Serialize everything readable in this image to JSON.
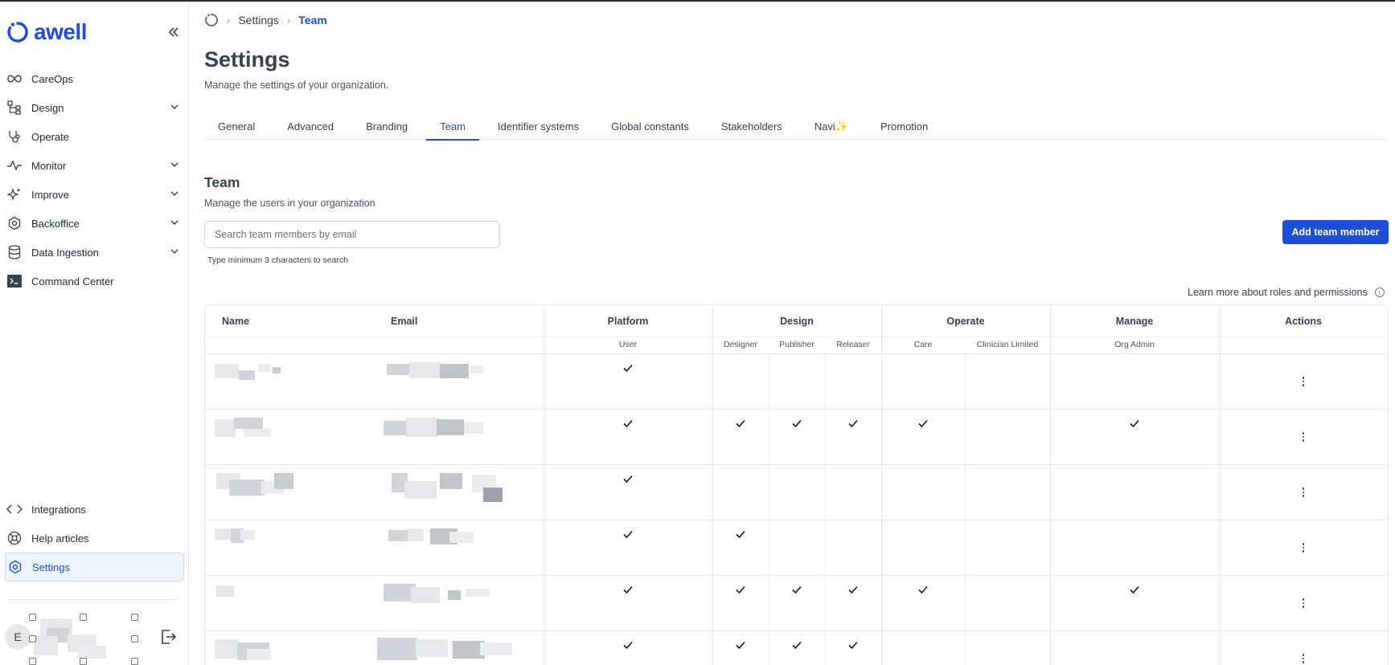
{
  "brand": {
    "name": "awell",
    "accent": "#1d4ed8"
  },
  "sidebar": {
    "items": [
      {
        "label": "CareOps",
        "icon": "infinity-icon",
        "chevron": false
      },
      {
        "label": "Design",
        "icon": "flow-tree-icon",
        "chevron": true
      },
      {
        "label": "Operate",
        "icon": "stethoscope-icon",
        "chevron": false
      },
      {
        "label": "Monitor",
        "icon": "pulse-icon",
        "chevron": true
      },
      {
        "label": "Improve",
        "icon": "sparkles-icon",
        "chevron": true
      },
      {
        "label": "Backoffice",
        "icon": "cog-icon",
        "chevron": true
      },
      {
        "label": "Data Ingestion",
        "icon": "database-icon",
        "chevron": true
      },
      {
        "label": "Command Center",
        "icon": "terminal-icon",
        "chevron": false
      }
    ],
    "bottom_items": [
      {
        "label": "Integrations",
        "icon": "code-icon"
      },
      {
        "label": "Help articles",
        "icon": "lifebuoy-icon"
      },
      {
        "label": "Settings",
        "icon": "settings-icon",
        "active": true
      }
    ],
    "user_initial": "E"
  },
  "breadcrumb": {
    "items": [
      "Settings",
      "Team"
    ]
  },
  "page": {
    "title": "Settings",
    "subtitle": "Manage the settings of your organization."
  },
  "tabs": [
    {
      "label": "General"
    },
    {
      "label": "Advanced"
    },
    {
      "label": "Branding"
    },
    {
      "label": "Team",
      "active": true
    },
    {
      "label": "Identifier systems"
    },
    {
      "label": "Global constants"
    },
    {
      "label": "Stakeholders"
    },
    {
      "label": "Navi✨"
    },
    {
      "label": "Promotion"
    }
  ],
  "team": {
    "title": "Team",
    "subtitle": "Manage the users in your organization",
    "search_placeholder": "Search team members by email",
    "search_hint": "Type minimum 3 characters to search",
    "add_button": "Add team member",
    "learn_more": "Learn more about roles and permissions"
  },
  "table": {
    "headers": {
      "name": "Name",
      "email": "Email",
      "platform": "Platform",
      "design": "Design",
      "operate": "Operate",
      "manage": "Manage",
      "actions": "Actions"
    },
    "subheaders": [
      "User",
      "Designer",
      "Publisher",
      "Releaser",
      "Care",
      "Clinician Limited",
      "Org Admin"
    ],
    "rows": [
      {
        "roles": [
          true,
          false,
          false,
          false,
          false,
          false,
          false
        ]
      },
      {
        "roles": [
          true,
          true,
          true,
          true,
          true,
          false,
          true
        ]
      },
      {
        "roles": [
          true,
          false,
          false,
          false,
          false,
          false,
          false
        ]
      },
      {
        "roles": [
          true,
          true,
          false,
          false,
          false,
          false,
          false
        ]
      },
      {
        "roles": [
          true,
          true,
          true,
          true,
          true,
          false,
          true
        ]
      },
      {
        "roles": [
          true,
          true,
          true,
          true,
          false,
          false,
          false
        ]
      }
    ]
  }
}
